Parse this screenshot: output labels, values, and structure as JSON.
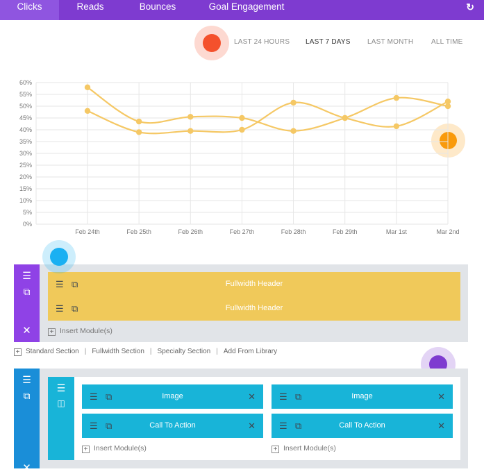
{
  "tabs": [
    {
      "label": "Clicks"
    },
    {
      "label": "Reads"
    },
    {
      "label": "Bounces"
    },
    {
      "label": "Goal Engagement"
    }
  ],
  "refresh_icon": "refresh-icon",
  "ranges": [
    "LAST 24 HOURS",
    "LAST 7 DAYS",
    "LAST MONTH",
    "ALL TIME"
  ],
  "active_range": "LAST 7 DAYS",
  "colors": {
    "tab_bar": "#7e3bd0",
    "line": "#f5c865",
    "hotspot_red": "#f4512c",
    "hotspot_orange": "#f99a0b",
    "hotspot_blue": "#1ab0f2",
    "hotspot_purple": "#7e3bd0",
    "section_purple": "#8f42e6",
    "section_blue": "#1a8ed8",
    "fullwidth_module": "#f0c95a",
    "cyan_module": "#18b4d8"
  },
  "chart_data": {
    "type": "line",
    "categories": [
      "Feb 24th",
      "Feb 25th",
      "Feb 26th",
      "Feb 27th",
      "Feb 28th",
      "Feb 29th",
      "Mar 1st",
      "Mar 2nd"
    ],
    "y_ticks": [
      "0%",
      "5%",
      "10%",
      "15%",
      "20%",
      "25%",
      "30%",
      "35%",
      "40%",
      "45%",
      "50%",
      "55%",
      "60%"
    ],
    "ylim": [
      0,
      60
    ],
    "series": [
      {
        "values": [
          58,
          43.5,
          45.5,
          45,
          39.5,
          45,
          53.5,
          50
        ]
      },
      {
        "values": [
          48,
          39,
          39.5,
          40,
          51.5,
          45,
          41.5,
          52
        ]
      }
    ],
    "grid": true,
    "title": "",
    "xlabel": "",
    "ylabel": ""
  },
  "builder": {
    "section1": {
      "modules": [
        {
          "label": "Fullwidth Header"
        },
        {
          "label": "Fullwidth Header"
        }
      ],
      "insert_label": "Insert Module(s)"
    },
    "add_links": [
      "Standard Section",
      "Fullwidth Section",
      "Specialty Section",
      "Add From Library"
    ],
    "section2": {
      "col1": [
        {
          "label": "Image"
        },
        {
          "label": "Call To Action"
        }
      ],
      "col2": [
        {
          "label": "Image"
        },
        {
          "label": "Call To Action"
        }
      ],
      "insert_label": "Insert Module(s)"
    }
  }
}
